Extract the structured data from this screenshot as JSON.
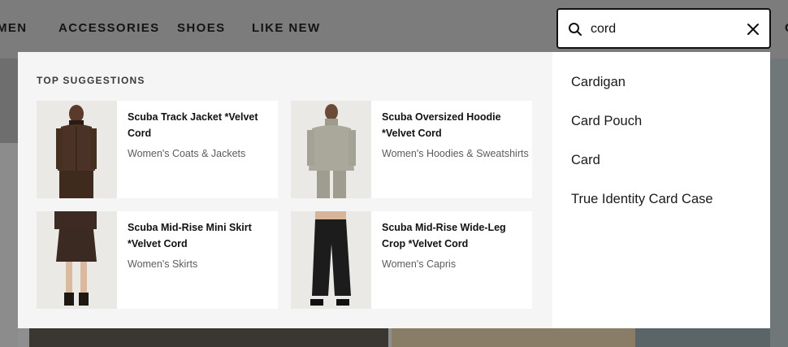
{
  "nav": {
    "items": [
      "MEN",
      "ACCESSORIES",
      "SHOES",
      "LIKE NEW"
    ],
    "cut_item": "C"
  },
  "search": {
    "value": "cord",
    "icon": "search-icon",
    "clear_icon": "close-icon"
  },
  "suggestions_panel": {
    "heading": "TOP SUGGESTIONS",
    "products": [
      {
        "title": "Scuba Track Jacket *Velvet Cord",
        "category": "Women's Coats & Jackets"
      },
      {
        "title": "Scuba Oversized Hoodie *Velvet Cord",
        "category": "Women's Hoodies & Sweatshirts"
      },
      {
        "title": "Scuba Mid-Rise Mini Skirt *Velvet Cord",
        "category": "Women's Skirts"
      },
      {
        "title": "Scuba Mid-Rise Wide-Leg Crop *Velvet Cord",
        "category": "Women's Capris"
      }
    ],
    "terms": [
      "Cardigan",
      "Card Pouch",
      "Card",
      "True Identity Card Case"
    ]
  },
  "colors": {
    "overlay": "#8f8f8f",
    "panel_left": "#f5f5f5",
    "panel_right": "#ffffff",
    "product_brown": "#4a3226",
    "product_sage": "#a9a89a",
    "product_black": "#1c1c1c"
  }
}
